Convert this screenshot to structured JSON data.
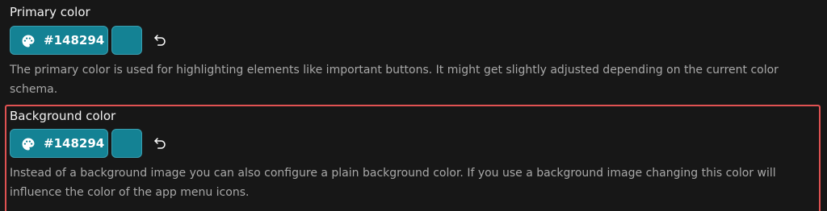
{
  "primary": {
    "label": "Primary color",
    "value": "#148294",
    "color": "#148294",
    "description": "The primary color is used for highlighting elements like important buttons. It might get slightly adjusted depending on the current color schema."
  },
  "background": {
    "label": "Background color",
    "value": "#148294",
    "color": "#148294",
    "description": "Instead of a background image you can also configure a plain background color. If you use a background image changing this color will influence the color of the app menu icons."
  },
  "icons": {
    "picker": "palette-icon",
    "reset": "undo-icon"
  },
  "highlight_color": "#e05252"
}
